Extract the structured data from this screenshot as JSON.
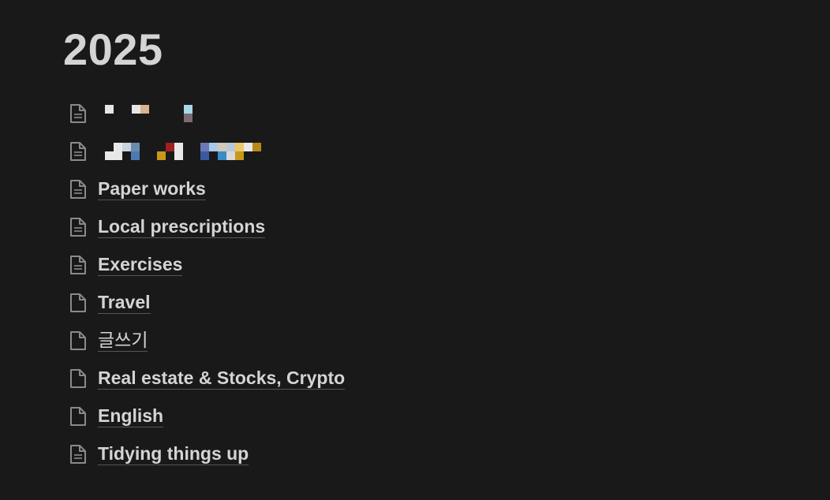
{
  "page": {
    "title": "2025"
  },
  "items": [
    {
      "label": "",
      "icon": "page-lines-icon",
      "redacted": true
    },
    {
      "label": "",
      "icon": "page-lines-icon",
      "redacted": true
    },
    {
      "label": "Paper works",
      "icon": "page-lines-icon"
    },
    {
      "label": "Local prescriptions",
      "icon": "page-lines-icon"
    },
    {
      "label": "Exercises",
      "icon": "page-lines-icon"
    },
    {
      "label": "Travel",
      "icon": "page-empty-icon"
    },
    {
      "label": "글쓰기",
      "icon": "page-empty-icon"
    },
    {
      "label": "Real estate & Stocks, Crypto",
      "icon": "page-empty-icon"
    },
    {
      "label": "English",
      "icon": "page-empty-icon"
    },
    {
      "label": "Tidying things up",
      "icon": "page-lines-icon"
    }
  ],
  "colors": {
    "background": "#191919",
    "text": "#d4d4d4",
    "icon": "#8a8a8a",
    "underline": "#555555"
  }
}
